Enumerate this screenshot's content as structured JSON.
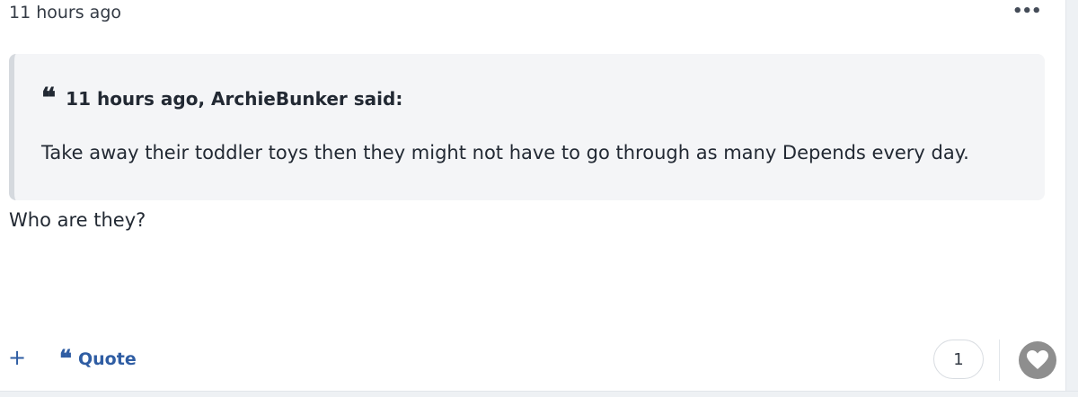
{
  "post": {
    "timestamp": "11 hours ago",
    "more_label": "•••",
    "quote": {
      "glyph": "❝",
      "citation": "11 hours ago, ArchieBunker said:",
      "text": "Take away their toddler toys then they might not have to go through as many Depends every day."
    },
    "body": "Who are they?"
  },
  "footer": {
    "plus_label": "+",
    "quote_glyph": "❝",
    "quote_label": "Quote",
    "reaction_count": "1",
    "like_icon": "heart-icon"
  },
  "colors": {
    "accent": "#2f5da3",
    "quote_bg": "#f4f5f7",
    "like_bg": "#8e8e8e"
  }
}
